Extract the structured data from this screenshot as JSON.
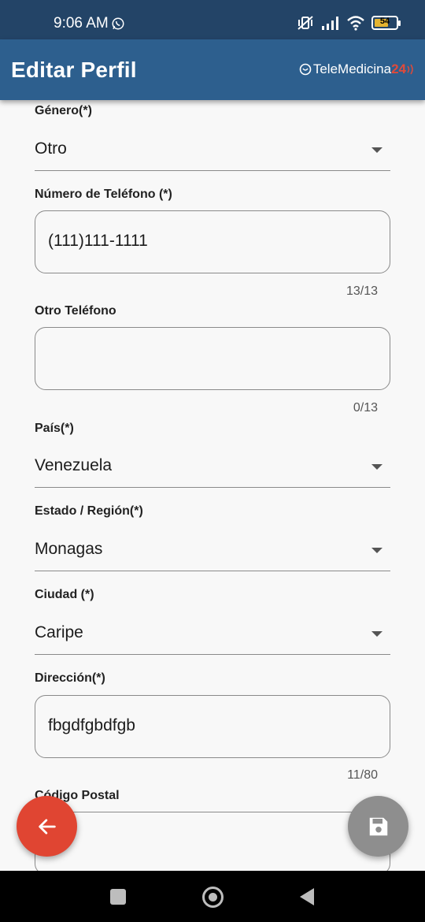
{
  "status_bar": {
    "time": "9:06 AM",
    "battery_level": "54",
    "icons": [
      "whatsapp-icon",
      "mute-vibrate-icon",
      "signal-icon",
      "wifi-icon",
      "battery-icon"
    ]
  },
  "app_bar": {
    "title": "Editar Perfil",
    "brand_name": "TeleMedicina",
    "brand_suffix": "24",
    "colors": {
      "status": "#234467",
      "bar": "#2d5f8e",
      "brand_accent": "#e04a3a"
    }
  },
  "form": {
    "genero": {
      "label": "Género(*)",
      "value": "Otro"
    },
    "telefono": {
      "label": "Número de Teléfono (*)",
      "value": "(111)111-1111",
      "counter": "13/13"
    },
    "otro_telefono": {
      "label": "Otro Teléfono",
      "value": "",
      "counter": "0/13"
    },
    "pais": {
      "label": "País(*)",
      "value": "Venezuela"
    },
    "estado": {
      "label": "Estado / Región(*)",
      "value": "Monagas"
    },
    "ciudad": {
      "label": "Ciudad (*)",
      "value": "Caripe"
    },
    "direccion": {
      "label": "Dirección(*)",
      "value": "fbgdfgbdfgb",
      "counter": "11/80"
    },
    "codigo_postal": {
      "label": "Código Postal",
      "value": ""
    }
  },
  "fabs": {
    "back": {
      "icon": "arrow-left-icon",
      "color": "#e04532"
    },
    "save": {
      "icon": "floppy-disk-icon",
      "color": "#8e8e8e"
    }
  },
  "nav_bar": {
    "icons": [
      "recents-square-icon",
      "home-circle-icon",
      "back-triangle-icon"
    ]
  }
}
